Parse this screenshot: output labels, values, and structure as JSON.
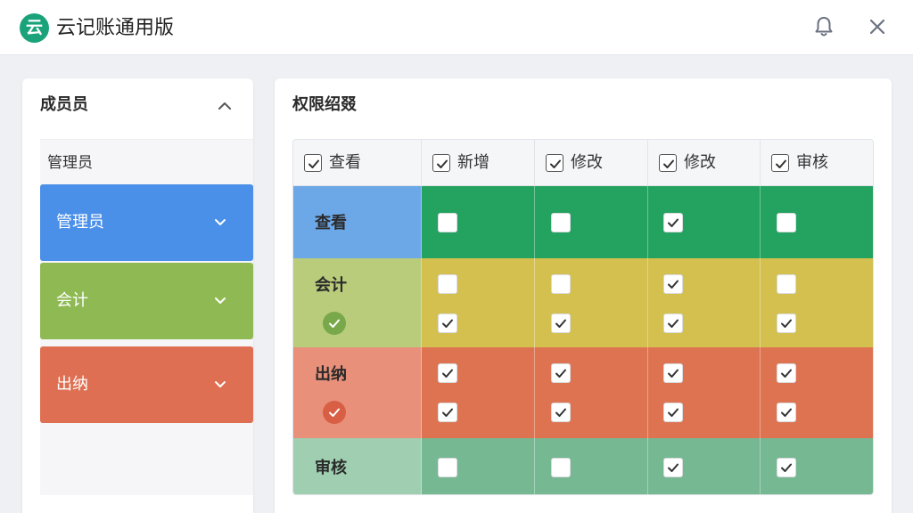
{
  "header": {
    "logo_text": "云",
    "title": "云记账通用版"
  },
  "icons": {
    "notification": "bell-icon",
    "close": "close-icon"
  },
  "members_panel": {
    "title": "成员员",
    "subgroup_label": "管理员",
    "roles": [
      {
        "label": "管理员",
        "color": "#4a8fe8"
      },
      {
        "label": "会计",
        "color": "#8fba53"
      },
      {
        "label": "出纳",
        "color": "#de6f52"
      }
    ]
  },
  "permissions_panel": {
    "title": "权限绍叕",
    "columns": [
      {
        "label": "查看",
        "checked": true
      },
      {
        "label": "新增",
        "checked": true
      },
      {
        "label": "修改",
        "checked": true
      },
      {
        "label": "修改",
        "checked": true
      },
      {
        "label": "审核",
        "checked": true
      }
    ],
    "rows": [
      {
        "label": "查看",
        "color": "#6ca8e8",
        "cell_color": "#23a35f",
        "checks": [
          [
            false,
            false,
            true,
            false
          ]
        ]
      },
      {
        "label": "会计",
        "color": "#b9cc7c",
        "cell_color": "#d3c04e",
        "status": "ok",
        "checks": [
          [
            false,
            false,
            true,
            false
          ],
          [
            true,
            true,
            true,
            true
          ]
        ]
      },
      {
        "label": "出纳",
        "color": "#e8907a",
        "cell_color": "#de7352",
        "status": "ok",
        "checks": [
          [
            true,
            true,
            true,
            true
          ],
          [
            true,
            true,
            true,
            true
          ]
        ]
      },
      {
        "label": "审核",
        "color": "#9fcfb0",
        "cell_color": "#76b892",
        "checks": [
          [
            false,
            false,
            true,
            true
          ]
        ]
      }
    ]
  }
}
